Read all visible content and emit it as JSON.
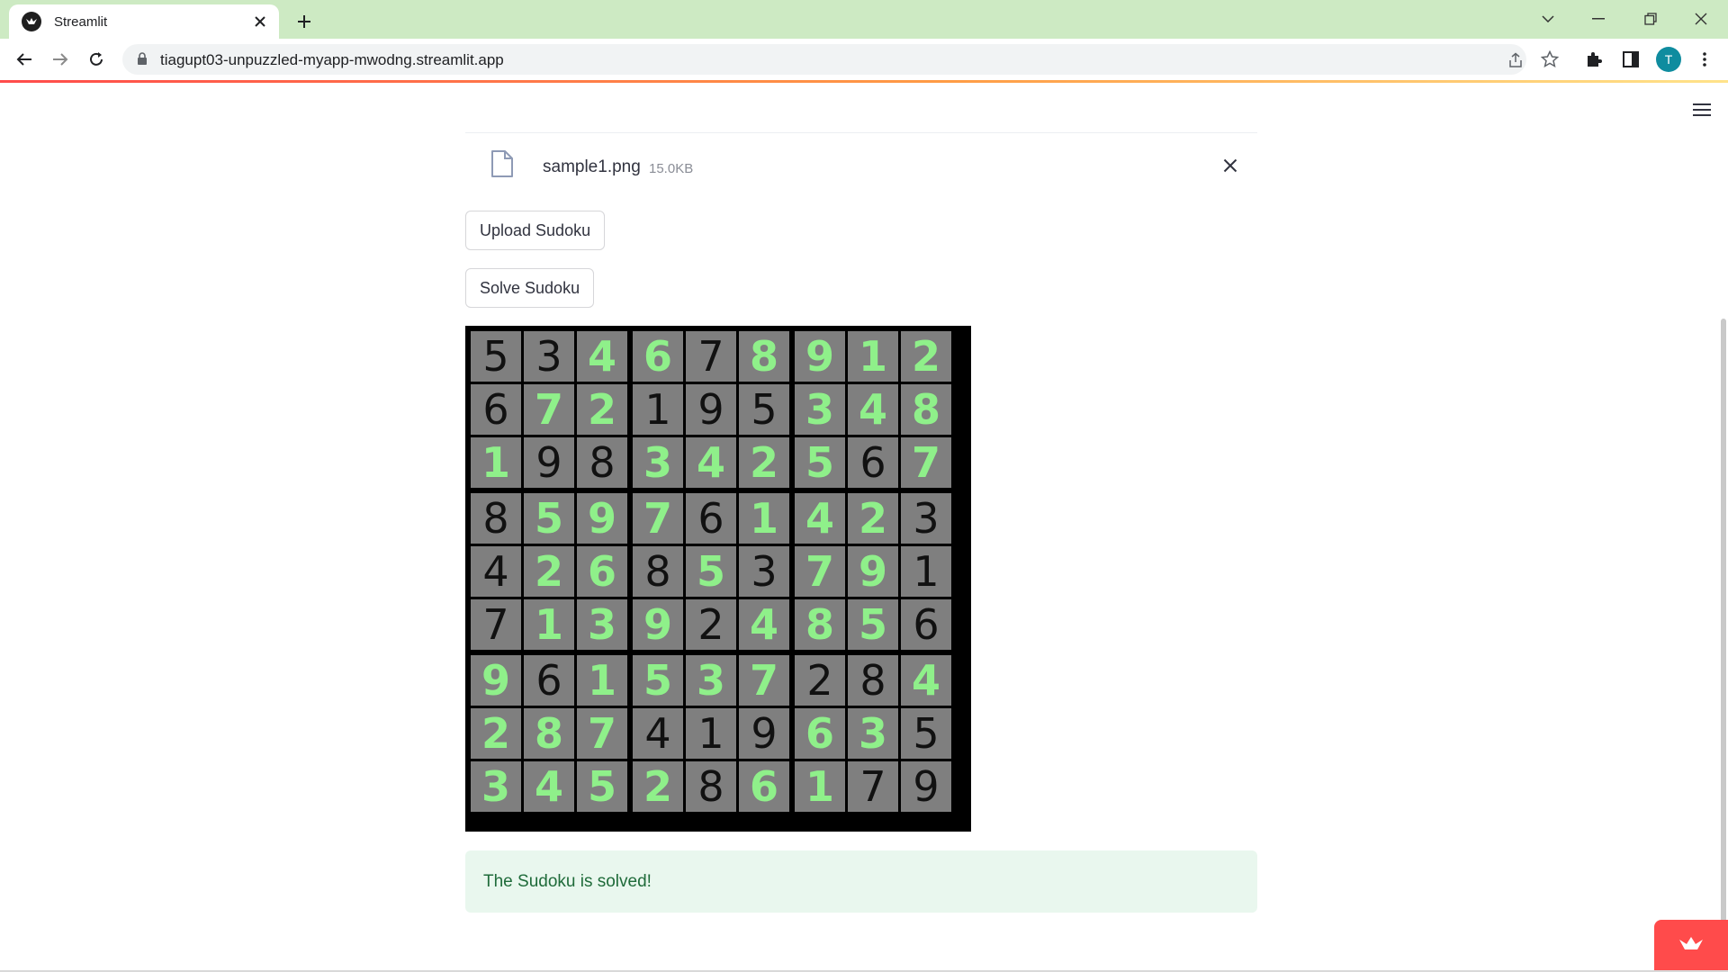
{
  "browser": {
    "tab_title": "Streamlit",
    "url": "tiagupt03-unpuzzled-myapp-mwodng.streamlit.app",
    "avatar_initial": "T"
  },
  "uploader": {
    "file_name": "sample1.png",
    "file_size": "15.0KB"
  },
  "buttons": {
    "upload_label": "Upload Sudoku",
    "solve_label": "Solve Sudoku"
  },
  "sudoku": {
    "grid": [
      [
        5,
        3,
        4,
        6,
        7,
        8,
        9,
        1,
        2
      ],
      [
        6,
        7,
        2,
        1,
        9,
        5,
        3,
        4,
        8
      ],
      [
        1,
        9,
        8,
        3,
        4,
        2,
        5,
        6,
        7
      ],
      [
        8,
        5,
        9,
        7,
        6,
        1,
        4,
        2,
        3
      ],
      [
        4,
        2,
        6,
        8,
        5,
        3,
        7,
        9,
        1
      ],
      [
        7,
        1,
        3,
        9,
        2,
        4,
        8,
        5,
        6
      ],
      [
        9,
        6,
        1,
        5,
        3,
        7,
        2,
        8,
        4
      ],
      [
        2,
        8,
        7,
        4,
        1,
        9,
        6,
        3,
        5
      ],
      [
        3,
        4,
        5,
        2,
        8,
        6,
        1,
        7,
        9
      ]
    ],
    "given": [
      [
        1,
        1,
        0,
        0,
        1,
        0,
        0,
        0,
        0
      ],
      [
        1,
        0,
        0,
        1,
        1,
        1,
        0,
        0,
        0
      ],
      [
        0,
        1,
        1,
        0,
        0,
        0,
        0,
        1,
        0
      ],
      [
        1,
        0,
        0,
        0,
        1,
        0,
        0,
        0,
        1
      ],
      [
        1,
        0,
        0,
        1,
        0,
        1,
        0,
        0,
        1
      ],
      [
        1,
        0,
        0,
        0,
        1,
        0,
        0,
        0,
        1
      ],
      [
        0,
        1,
        0,
        0,
        0,
        0,
        1,
        1,
        0
      ],
      [
        0,
        0,
        0,
        1,
        1,
        1,
        0,
        0,
        1
      ],
      [
        0,
        0,
        0,
        0,
        1,
        0,
        0,
        1,
        1
      ]
    ],
    "solved_color": "#8ff08a",
    "given_color": "#111111",
    "cell_color": "#7f7f7f"
  },
  "alert": {
    "message": "The Sudoku is solved!"
  },
  "colors": {
    "tabstrip": "#cdeac3",
    "accent": "#ff4b4b",
    "success_bg": "#e9f7ee",
    "success_text": "#1f6b3a"
  }
}
